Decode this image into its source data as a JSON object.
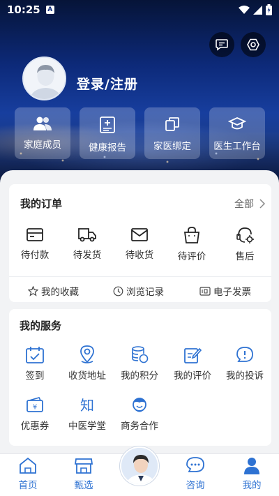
{
  "status_bar": {
    "time": "10:25",
    "badge": "A"
  },
  "header": {
    "login_text": "登录/注册",
    "quick_actions": [
      {
        "label": "家庭成员",
        "icon": "family-icon"
      },
      {
        "label": "健康报告",
        "icon": "report-icon"
      },
      {
        "label": "家医绑定",
        "icon": "bind-icon"
      },
      {
        "label": "医生工作台",
        "icon": "doctor-hat-icon"
      }
    ]
  },
  "orders": {
    "title": "我的订单",
    "all_label": "全部",
    "items": [
      {
        "label": "待付款",
        "icon": "wallet-icon"
      },
      {
        "label": "待发货",
        "icon": "truck-icon"
      },
      {
        "label": "待收货",
        "icon": "envelope-icon"
      },
      {
        "label": "待评价",
        "icon": "bag-icon"
      },
      {
        "label": "售后",
        "icon": "service-icon"
      }
    ],
    "links": [
      {
        "label": "我的收藏",
        "icon": "star-icon"
      },
      {
        "label": "浏览记录",
        "icon": "clock-icon"
      },
      {
        "label": "电子发票",
        "icon": "invoice-icon"
      }
    ]
  },
  "services": {
    "title": "我的服务",
    "items": [
      {
        "label": "签到",
        "icon": "calendar-icon"
      },
      {
        "label": "收货地址",
        "icon": "location-icon"
      },
      {
        "label": "我的积分",
        "icon": "coins-icon"
      },
      {
        "label": "我的评价",
        "icon": "edit-icon"
      },
      {
        "label": "我的投诉",
        "icon": "alert-icon"
      },
      {
        "label": "优惠券",
        "icon": "coupon-icon"
      },
      {
        "label": "中医学堂",
        "icon": "zhi-icon",
        "glyph": "知"
      },
      {
        "label": "商务合作",
        "icon": "person-icon"
      }
    ]
  },
  "nav": {
    "items": [
      {
        "label": "首页",
        "icon": "home-icon"
      },
      {
        "label": "甄选",
        "icon": "shop-icon"
      },
      {
        "label": "咨询",
        "icon": "chat-icon"
      },
      {
        "label": "我的",
        "icon": "user-icon"
      }
    ]
  },
  "colors": {
    "accent": "#2e72d2",
    "header_dark": "#0d2a7a"
  }
}
